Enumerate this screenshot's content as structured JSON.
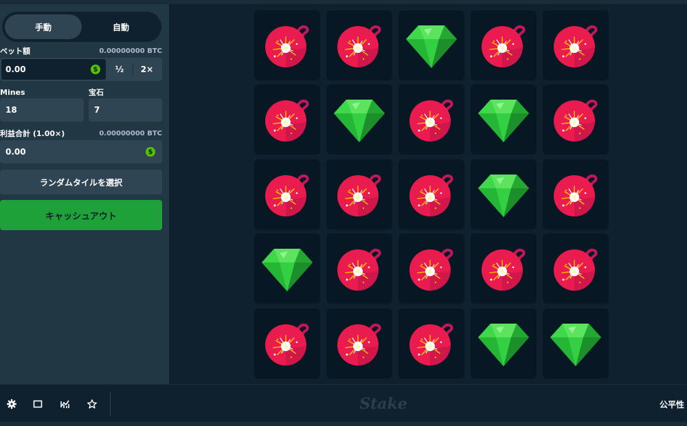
{
  "mode_tabs": {
    "manual": "手動",
    "auto": "自動"
  },
  "bet": {
    "label": "ベット額",
    "balance": "0.00000000 BTC",
    "value": "0.00",
    "currency_symbol": "$",
    "half_label": "½",
    "double_label": "2×"
  },
  "mines": {
    "label": "Mines",
    "value": "18"
  },
  "gems": {
    "label": "宝石",
    "value": "7"
  },
  "profit": {
    "label": "利益合計 (1.00×)",
    "amount_btc": "0.00000000 BTC",
    "value": "0.00",
    "currency_symbol": "$"
  },
  "random_tile_label": "ランダムタイルを選択",
  "cashout_label": "キャッシュアウト",
  "board": {
    "rows": [
      [
        "bomb",
        "bomb",
        "gem",
        "bomb",
        "bomb"
      ],
      [
        "bomb",
        "gem",
        "bomb",
        "gem",
        "bomb"
      ],
      [
        "bomb",
        "bomb",
        "bomb",
        "gem",
        "bomb"
      ],
      [
        "gem",
        "bomb",
        "bomb",
        "bomb",
        "bomb"
      ],
      [
        "bomb",
        "bomb",
        "bomb",
        "gem",
        "gem"
      ]
    ]
  },
  "footer": {
    "icons": [
      "gear-icon",
      "theatre-mode-icon",
      "stats-icon",
      "favorite-star-icon"
    ],
    "logo": "Stake",
    "fairness_label": "公平性"
  },
  "colors": {
    "accent_green": "#1fa13a",
    "bomb_red": "#ea1b4e",
    "gem_green": "#2ecc40",
    "sidebar": "#213743",
    "field": "#2f4553",
    "tile": "#071824"
  }
}
